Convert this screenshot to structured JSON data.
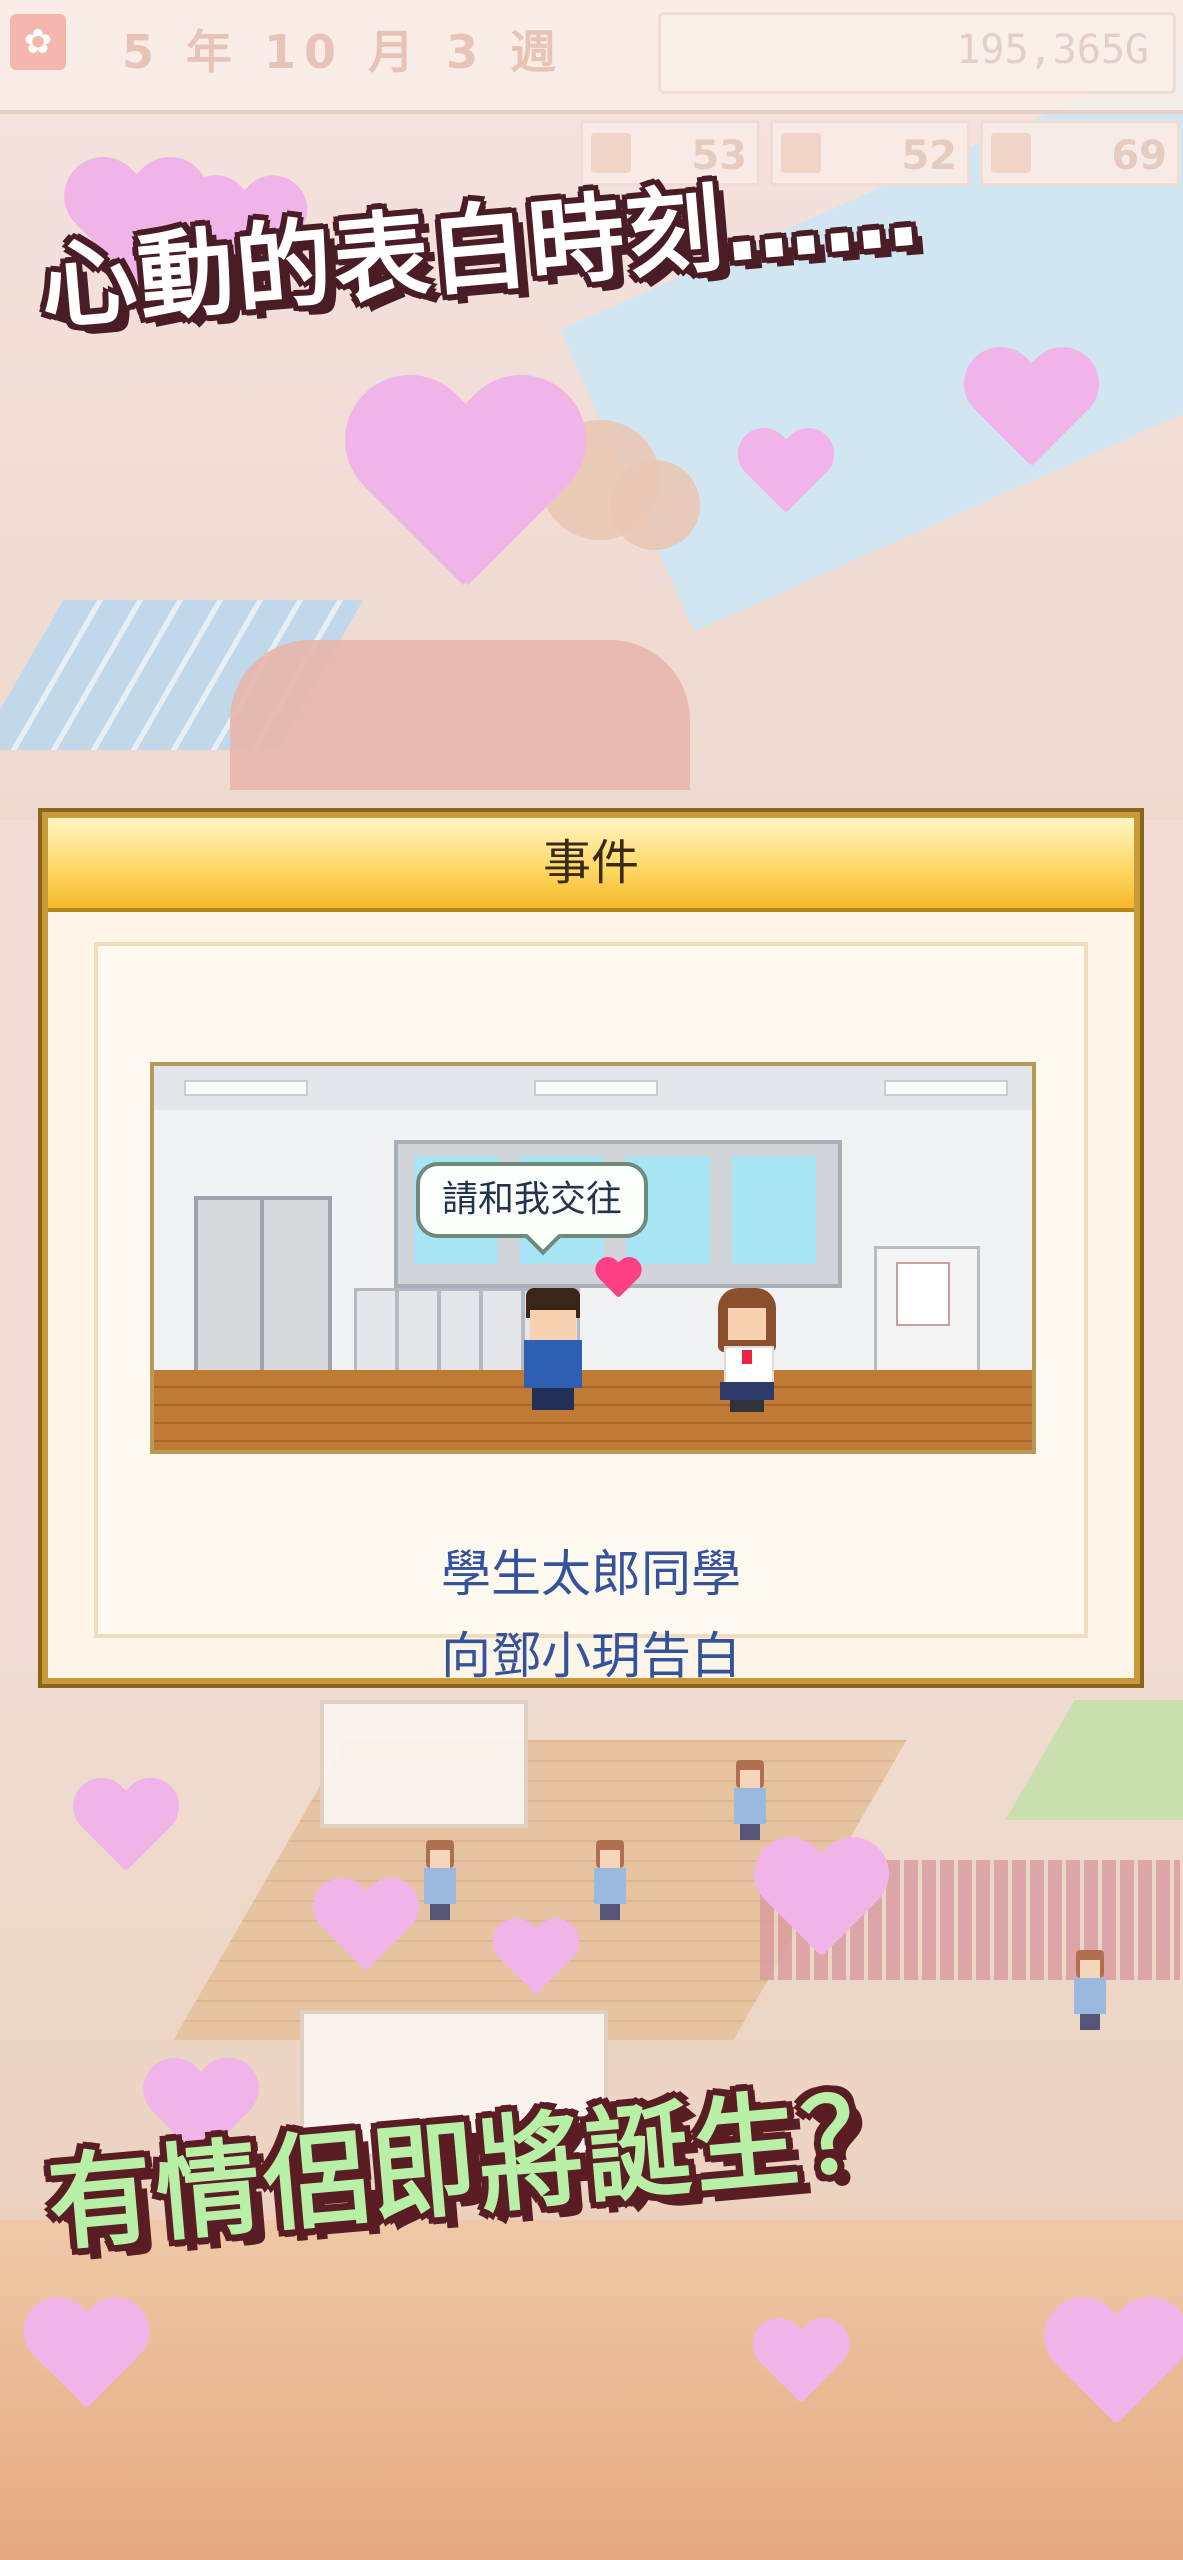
{
  "hud": {
    "date_text": "5 年 10 月 3 週",
    "money": "195,365G",
    "stats": [
      "53",
      "52",
      "69"
    ]
  },
  "captions": {
    "top": "心動的表白時刻……",
    "bottom": "有情侶即將誕生？"
  },
  "event_dialog": {
    "title": "事件",
    "speech_bubble": "請和我交往",
    "message_line1": "學生太郎同學",
    "message_line2": "向鄧小玥告白"
  },
  "colors": {
    "heart_pink": "#f0b4e8",
    "heart_red": "#ff3f84",
    "dialog_header": "#ffd966",
    "message_blue": "#34539a",
    "caption_green": "#b8f0a8"
  }
}
